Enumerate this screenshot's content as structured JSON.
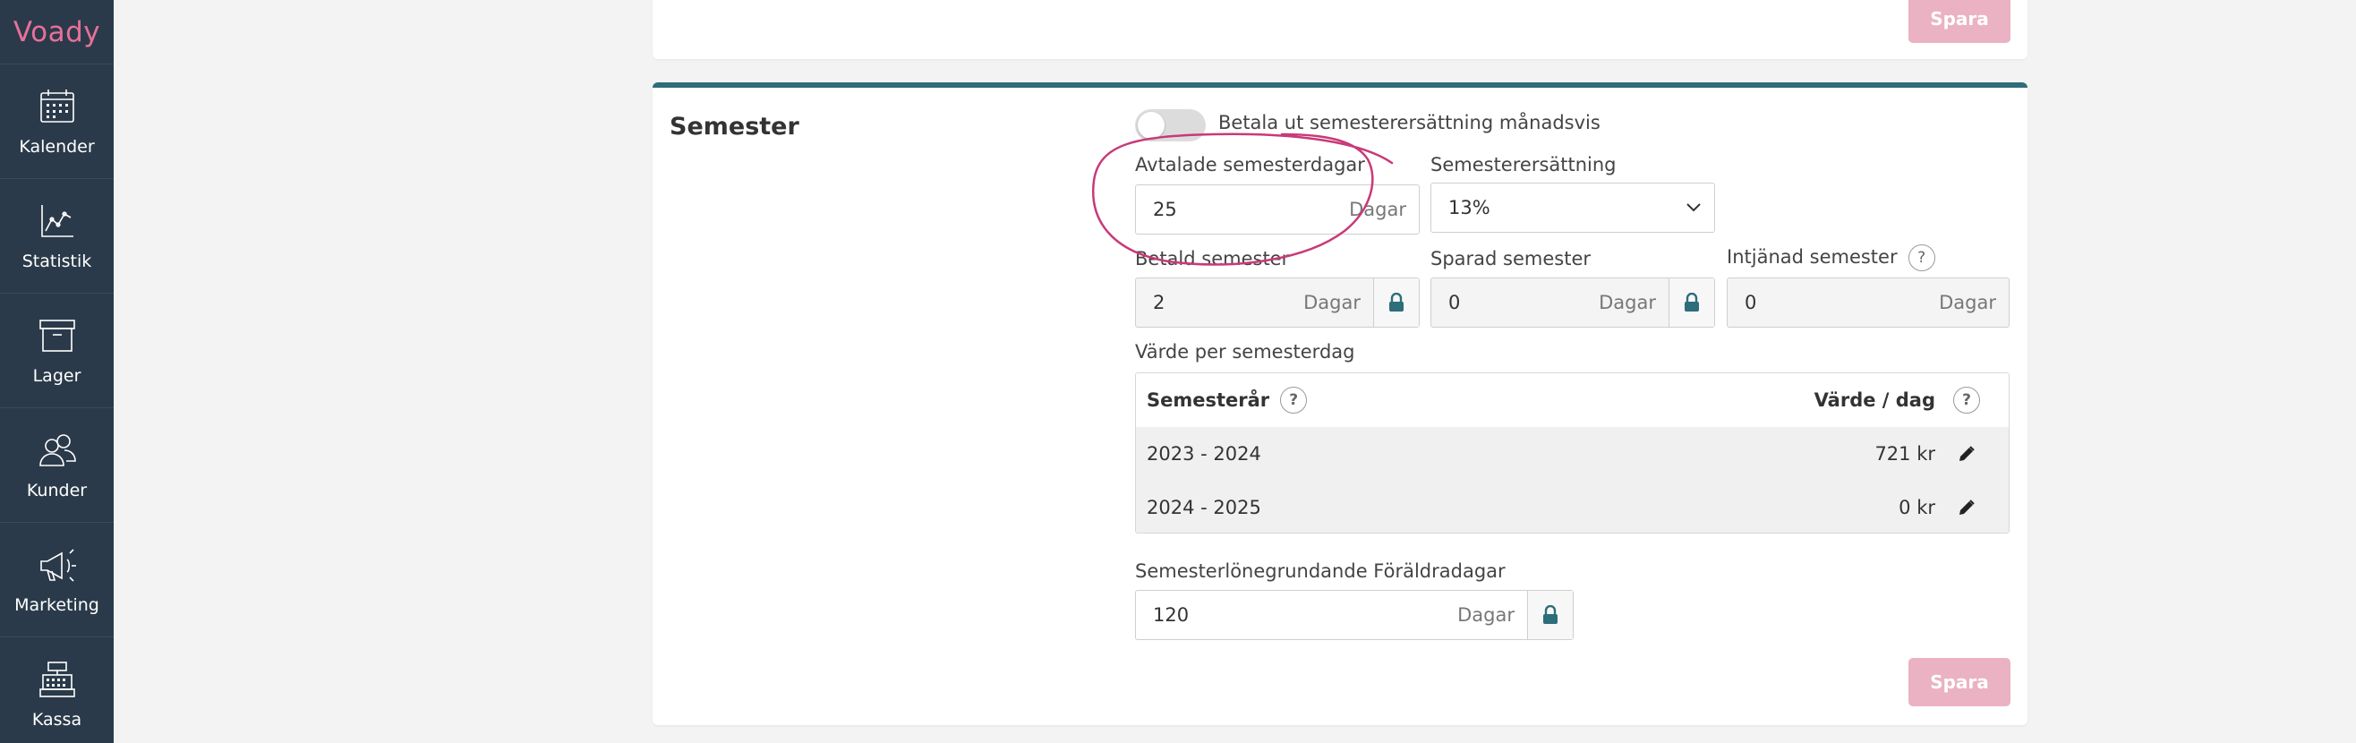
{
  "brand": {
    "logo_text": "Voady",
    "logo_color": "#e7709a"
  },
  "sidebar": {
    "items": [
      {
        "label": "Kalender",
        "icon": "calendar-icon"
      },
      {
        "label": "Statistik",
        "icon": "chart-icon"
      },
      {
        "label": "Lager",
        "icon": "archive-icon"
      },
      {
        "label": "Kunder",
        "icon": "users-icon"
      },
      {
        "label": "Marketing",
        "icon": "megaphone-icon"
      },
      {
        "label": "Kassa",
        "icon": "cash-register-icon"
      }
    ]
  },
  "top_card": {
    "save_label": "Spara"
  },
  "semester": {
    "title": "Semester",
    "toggle": {
      "label": "Betala ut semesterersättning månadsvis",
      "on": false
    },
    "avtalade": {
      "label": "Avtalade semesterdagar",
      "value": "25",
      "unit": "Dagar"
    },
    "ersattning": {
      "label": "Semesterersättning",
      "value": "13%"
    },
    "betald": {
      "label": "Betald semester",
      "value": "2",
      "unit": "Dagar"
    },
    "sparad": {
      "label": "Sparad semester",
      "value": "0",
      "unit": "Dagar"
    },
    "intjanad": {
      "label": "Intjänad semester",
      "help": "?",
      "value": "0",
      "unit": "Dagar"
    },
    "varde_table": {
      "label": "Värde per semesterdag",
      "headers": {
        "year": "Semesterår",
        "value": "Värde / dag",
        "help": "?"
      },
      "rows": [
        {
          "year": "2023 - 2024",
          "value": "721 kr"
        },
        {
          "year": "2024 - 2025",
          "value": "0 kr"
        }
      ]
    },
    "foraldra": {
      "label": "Semesterlönegrundande Föräldradagar",
      "value": "120",
      "unit": "Dagar"
    },
    "save_label": "Spara"
  },
  "colors": {
    "sidebar_bg": "#2b3a4a",
    "accent_teal": "#2e6d7a",
    "save_button": "#eab2c3",
    "annotation": "#c83a78"
  }
}
